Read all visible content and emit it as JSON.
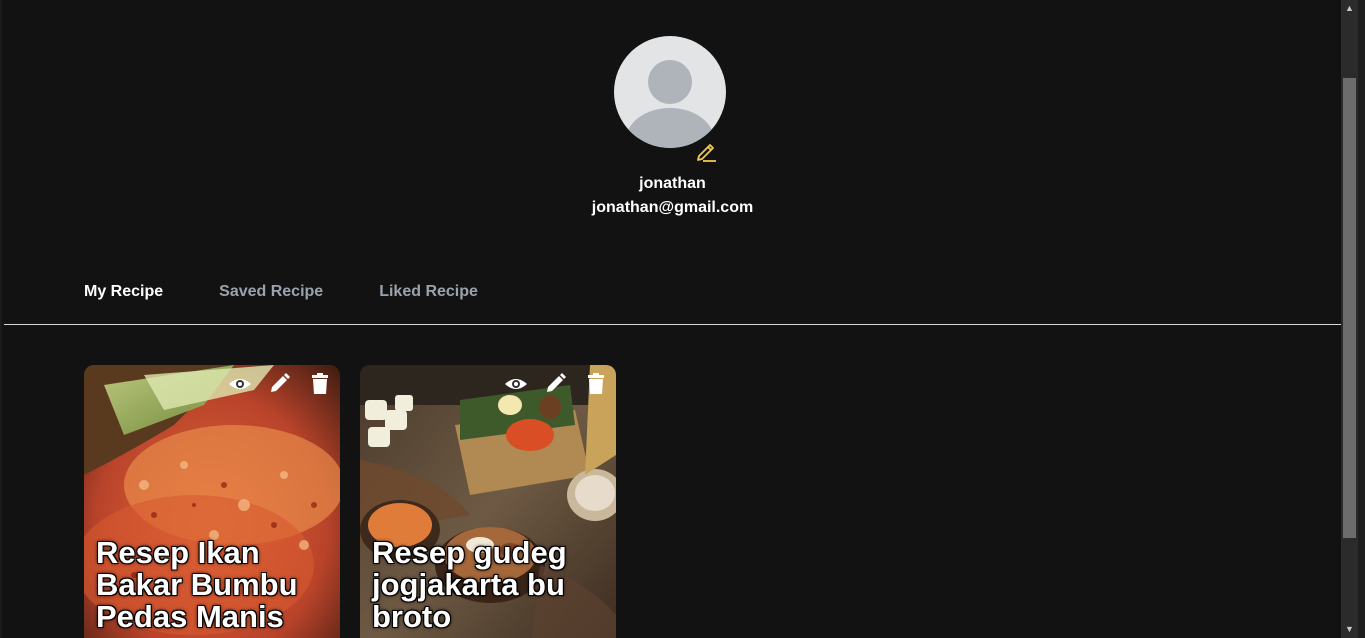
{
  "profile": {
    "username": "jonathan",
    "email": "jonathan@gmail.com"
  },
  "tabs": [
    {
      "label": "My Recipe",
      "active": true
    },
    {
      "label": "Saved Recipe",
      "active": false
    },
    {
      "label": "Liked Recipe",
      "active": false
    }
  ],
  "recipes": [
    {
      "title": "Resep Ikan Bakar Bumbu Pedas Manis"
    },
    {
      "title": "Resep gudeg jogjakarta bu broto"
    }
  ],
  "icons": {
    "edit_avatar": "pencil-icon",
    "view": "eye-icon",
    "edit": "pencil-icon",
    "delete": "trash-icon"
  },
  "colors": {
    "background": "#121212",
    "accent_edit": "#f2c94c",
    "tab_active": "#ffffff",
    "tab_inactive": "#9aa3ad"
  }
}
